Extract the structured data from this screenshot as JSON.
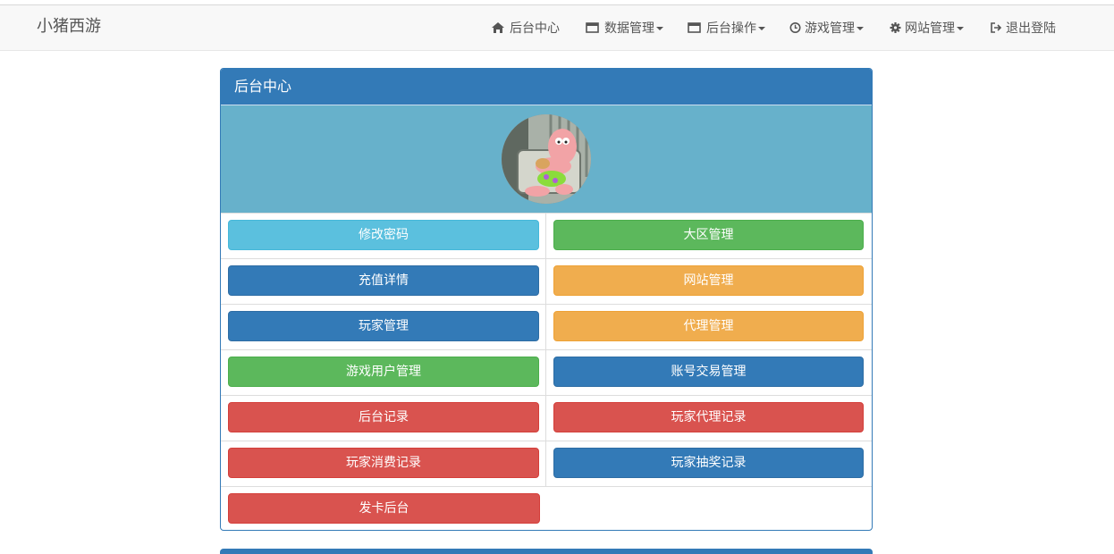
{
  "app": {
    "brand": "小猪西游"
  },
  "nav": [
    {
      "label": "后台中心",
      "icon": "home-icon",
      "dropdown": false
    },
    {
      "label": "数据管理",
      "icon": "window-icon",
      "dropdown": true
    },
    {
      "label": "后台操作",
      "icon": "window-icon",
      "dropdown": true
    },
    {
      "label": "游戏管理",
      "icon": "clock-icon",
      "dropdown": true
    },
    {
      "label": "网站管理",
      "icon": "gear-icon",
      "dropdown": true
    },
    {
      "label": "退出登陆",
      "icon": "logout-icon",
      "dropdown": false
    }
  ],
  "panel": {
    "title": "后台中心",
    "avatar": "avatar-image",
    "buttons": [
      [
        {
          "label": "修改密码",
          "style": "info"
        },
        {
          "label": "大区管理",
          "style": "success"
        }
      ],
      [
        {
          "label": "充值详情",
          "style": "primary"
        },
        {
          "label": "网站管理",
          "style": "warning"
        }
      ],
      [
        {
          "label": "玩家管理",
          "style": "primary"
        },
        {
          "label": "代理管理",
          "style": "warning"
        }
      ],
      [
        {
          "label": "游戏用户管理",
          "style": "success"
        },
        {
          "label": "账号交易管理",
          "style": "primary"
        }
      ],
      [
        {
          "label": "后台记录",
          "style": "danger"
        },
        {
          "label": "玩家代理记录",
          "style": "danger"
        }
      ],
      [
        {
          "label": "玩家消费记录",
          "style": "danger"
        },
        {
          "label": "玩家抽奖记录",
          "style": "primary"
        }
      ],
      [
        {
          "label": "发卡后台",
          "style": "danger"
        }
      ]
    ]
  },
  "colors": {
    "primary": "#337ab7",
    "info": "#5bc0de",
    "success": "#5cb85c",
    "warning": "#f0ad4e",
    "danger": "#d9534f",
    "avatar_bg": "#67b1cb"
  }
}
